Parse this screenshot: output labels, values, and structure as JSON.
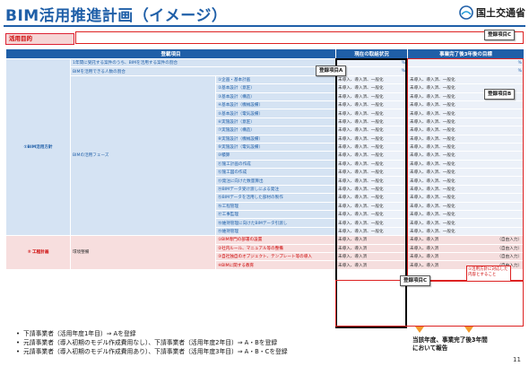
{
  "header": {
    "title": "BIM活用推進計画（イメージ）",
    "ministry": "国土交通省"
  },
  "purpose": {
    "label": "活用目的"
  },
  "callouts": {
    "a": "登録項目A",
    "b": "登録項目B",
    "c1": "登録項目C",
    "c2": "登録項目C"
  },
  "table": {
    "headers": [
      "登載項目",
      "現在の取組状況",
      "事業完了後3年後の目標"
    ],
    "sections": [
      {
        "category": "①BIM活用方針",
        "rows": [
          {
            "label": "1年間に受託する案件のうち、BIMを活用する案件の割合",
            "current": "%",
            "target": "%",
            "pct": true
          },
          {
            "label": "BIMを活用できる人数の割合",
            "current": "%",
            "target": "%",
            "pct": true
          }
        ],
        "subgroup": "BIMの活用フェーズ",
        "items": [
          "①企画・基本計画",
          "②基本設計（意匠）",
          "③基本設計（構造）",
          "④基本設計（機械設備）",
          "⑤基本設計（電気設備）",
          "⑥実施設計（意匠）",
          "⑦実施設計（構造）",
          "⑧実施設計（機械設備）",
          "⑨実施設計（電気設備）",
          "⑩積算",
          "⑪施工計画の作成",
          "⑫施工図の作成",
          "⑬発注に向けた数量算出",
          "⑭BIMデータ受け渡しによる発注",
          "⑮BIMデータを活用した部材の製作",
          "⑯工程管理",
          "⑰工事監理",
          "⑱維持管理に向けたBIMデータ引渡し",
          "⑲維持管理"
        ],
        "item_status": "未導入、導入済、一般化"
      },
      {
        "category": "② 工程計画",
        "subgroup": "環境整備",
        "items": [
          "①BIM専門の部署の設置",
          "②社内ルール、マニュアル等の整備",
          "③自社独自のオブジェクト、テンプレート等の導入",
          "④BIMに関する教育"
        ],
        "item_status": "未導入、導入済",
        "free_input": "（自由入力）"
      }
    ],
    "note": "①活用方針に対応した内容とすること"
  },
  "bullets": [
    "下請事業者（活用年度1年目）⇒ Aを登録",
    "元請事業者（導入初期のモデル作成費用なし）、下請事業者（活用年度2年目）⇒ A・Bを登録",
    "元請事業者（導入初期のモデル作成費用あり）、下請事業者（活用年度3年目）⇒ A・B・Cを登録"
  ],
  "report": {
    "line1": "当該年度、事業完了後3年間",
    "line2": "において報告"
  },
  "page_number": "11",
  "colors": {
    "brand_blue": "#1f5fa8",
    "alert_red": "#d22",
    "arrow_orange": "#f39a2c"
  }
}
